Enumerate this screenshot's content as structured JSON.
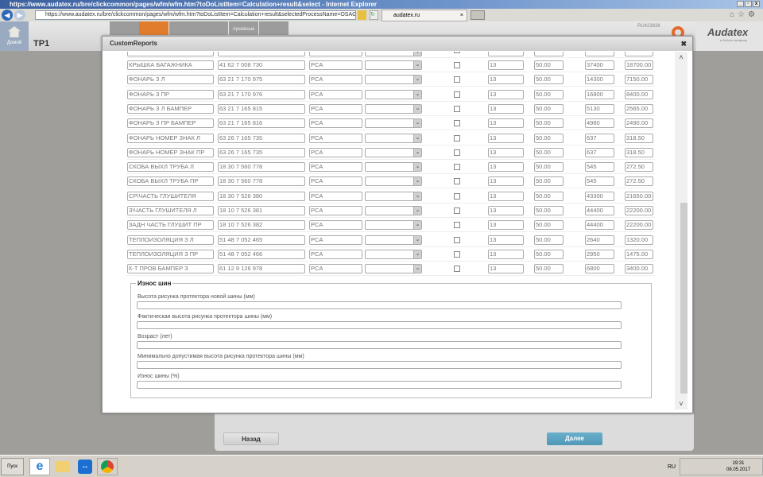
{
  "browser": {
    "title": "https://www.audatex.ru/bre/clickcommon/pages/wfm/wfm.htm?toDoListItem=Calculation+result&select - Internet Explorer",
    "url": "https://www.audatex.ru/bre/clickcommon/pages/wfm/wfm.htm?toDoListItem=Calculation+result&selectedProcessName=OSAGO&task",
    "tab": "audatex.ru"
  },
  "app": {
    "home": "Домой",
    "title": "TP1",
    "user_code": "RU423838",
    "archive_tab": "Архивные",
    "logo": "Audatex",
    "logo_sub": "a Solera company",
    "accent": "#e07c2c"
  },
  "modal": {
    "title": "CustomReports",
    "rows": [
      {
        "name": "КРЫШКА БАГАЖНИКА",
        "code": "41 62 7 008 730",
        "type": "PCA",
        "qty": "13",
        "pct": "50.00",
        "price": "37400",
        "sum": "18700.00"
      },
      {
        "name": "ФОНАРЬ З Л",
        "code": "63 21 7 170 975",
        "type": "PCA",
        "qty": "13",
        "pct": "50.00",
        "price": "14300",
        "sum": "7150.00"
      },
      {
        "name": "ФОНАРЬ З ПР",
        "code": "63 21 7 170 976",
        "type": "PCA",
        "qty": "13",
        "pct": "50.00",
        "price": "16800",
        "sum": "8400.00"
      },
      {
        "name": "ФОНАРЬ З Л БАМПЕР",
        "code": "63 21 7 165 815",
        "type": "PCA",
        "qty": "13",
        "pct": "50.00",
        "price": "5130",
        "sum": "2565.00"
      },
      {
        "name": "ФОНАРЬ З ПР БАМПЕР",
        "code": "63 21 7 165 816",
        "type": "PCA",
        "qty": "13",
        "pct": "50.00",
        "price": "4980",
        "sum": "2490.00"
      },
      {
        "name": "ФОНАРЬ НОМЕР ЗНАК Л",
        "code": "63 26 7 165 735",
        "type": "PCA",
        "qty": "13",
        "pct": "50.00",
        "price": "637",
        "sum": "318.50"
      },
      {
        "name": "ФОНАРЬ НОМЕР ЗНАК ПР",
        "code": "63 26 7 165 735",
        "type": "PCA",
        "qty": "13",
        "pct": "50.00",
        "price": "637",
        "sum": "318.50"
      },
      {
        "name": "СКОБА ВЫХЛ ТРУБА Л",
        "code": "18 30 7 560 778",
        "type": "PCA",
        "qty": "13",
        "pct": "50.00",
        "price": "545",
        "sum": "272.50"
      },
      {
        "name": "СКОБА ВЫХЛ ТРУБА ПР",
        "code": "18 30 7 560 778",
        "type": "PCA",
        "qty": "13",
        "pct": "50.00",
        "price": "545",
        "sum": "272.50"
      },
      {
        "name": "СР\\ЧАСТЬ ГЛУШИТЕЛЯ",
        "code": "18 30 7 526 380",
        "type": "PCA",
        "qty": "13",
        "pct": "50.00",
        "price": "43300",
        "sum": "21650.00"
      },
      {
        "name": "З\\ЧАСТЬ ГЛУШИТЕЛЯ Л",
        "code": "18 10 7 526 381",
        "type": "PCA",
        "qty": "13",
        "pct": "50.00",
        "price": "44400",
        "sum": "22200.00"
      },
      {
        "name": "ЗАДН ЧАСТЬ ГЛУШИТ ПР",
        "code": "18 10 7 526 382",
        "type": "PCA",
        "qty": "13",
        "pct": "50.00",
        "price": "44400",
        "sum": "22200.00"
      },
      {
        "name": "ТЕПЛОИЗОЛЯЦИЯ З Л",
        "code": "51 48 7 052 465",
        "type": "PCA",
        "qty": "13",
        "pct": "50.00",
        "price": "2640",
        "sum": "1320.00"
      },
      {
        "name": "ТЕПЛОИЗОЛЯЦИЯ З ПР",
        "code": "51 48 7 052 466",
        "type": "PCA",
        "qty": "13",
        "pct": "50.00",
        "price": "2950",
        "sum": "1475.00"
      },
      {
        "name": "К-Т ПРОВ БАМПЕР З",
        "code": "61 12 9 126 978",
        "type": "PCA",
        "qty": "13",
        "pct": "50.00",
        "price": "6800",
        "sum": "3400.00"
      }
    ],
    "tire": {
      "title": "Износ шин",
      "fields": [
        "Высота рисунка протектора новой шины (мм)",
        "Фактическая высота рисунка протектора шины (мм)",
        "Возраст (лет)",
        "Минимально допустимая высота рисунка протектора шины (мм)",
        "Износ шины (%)"
      ]
    }
  },
  "buttons": {
    "back": "Назад",
    "next": "Далее"
  },
  "taskbar": {
    "start": "Пуск",
    "lang": "RU",
    "time": "19:31",
    "date": "08.05.2017"
  }
}
